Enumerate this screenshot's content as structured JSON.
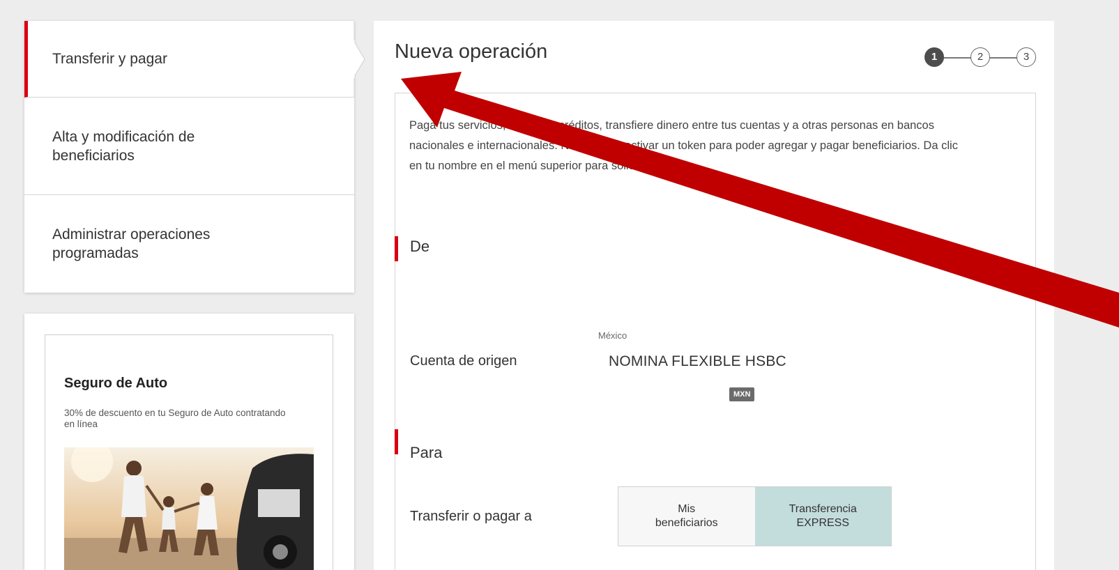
{
  "nav": {
    "items": [
      {
        "label": "Transferir y pagar",
        "active": true
      },
      {
        "label": "Alta y modificación de\nbeneficiarios",
        "active": false
      },
      {
        "label": "Administrar operaciones\nprogramadas",
        "active": false
      }
    ]
  },
  "promo": {
    "title": "Seguro de Auto",
    "description": "30% de descuento en tu Seguro de Auto contratando en línea"
  },
  "main": {
    "title": "Nueva operación",
    "steps": [
      "1",
      "2",
      "3"
    ],
    "current_step": 1,
    "intro": "Paga tus servicios, tarjetas y créditos, transfiere dinero entre tus cuentas y a otras personas en bancos nacionales e internacionales. Necesitarás activar un token para poder agregar y pagar beneficiarios. Da clic en tu nombre en el menú superior para solicitarlo.",
    "section_from": {
      "title": "De",
      "origin_label": "Cuenta de origen",
      "country": "México",
      "account_name": "NOMINA FLEXIBLE HSBC",
      "currency": "MXN"
    },
    "section_to": {
      "title": "Para",
      "transfer_label": "Transferir o pagar a",
      "options": [
        "Mis\nbeneficiarios",
        "Transferencia\nEXPRESS"
      ],
      "selected_option": 1
    }
  },
  "colors": {
    "accent_red": "#db0011",
    "selected_teal": "#c3dcdc",
    "annotation_arrow": "#c00000"
  },
  "icons": {
    "annotation": "red-arrow-icon"
  }
}
